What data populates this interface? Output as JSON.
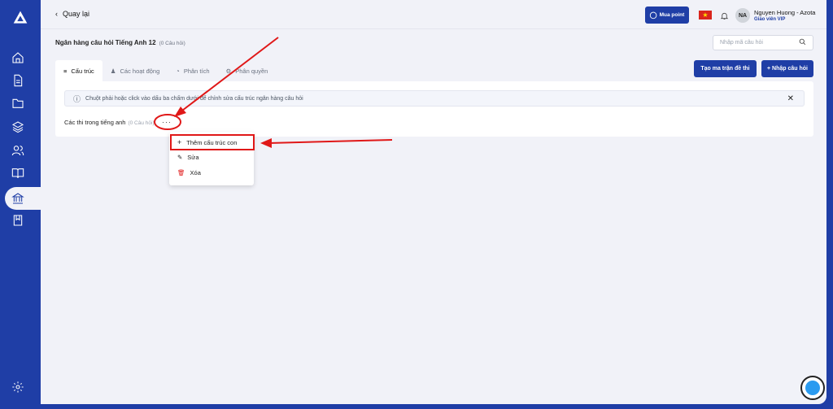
{
  "topbar": {
    "back_label": "Quay lại",
    "buy_point_label": "Mua point",
    "user_initials": "NA",
    "user_name": "Nguyen Huong - Azota",
    "user_role": "Giáo viên VIP"
  },
  "bank": {
    "title": "Ngân hàng câu hỏi Tiếng Anh 12",
    "count": "(0 Câu hỏi)",
    "search_placeholder": "Nhập mã câu hỏi"
  },
  "tabs": [
    {
      "label": "Cấu trúc",
      "icon": "list-icon"
    },
    {
      "label": "Các hoạt động",
      "icon": "users-icon"
    },
    {
      "label": "Phân tích",
      "icon": "chart-pie-icon"
    },
    {
      "label": "Phân quyền",
      "icon": "gear-icon"
    }
  ],
  "actions": {
    "matrix_label": "Tạo ma trận đề thi",
    "import_label": "+ Nhập câu hỏi"
  },
  "notice": {
    "text": "Chuột phải hoặc click vào dấu ba chấm dưới để chỉnh sửa cấu trúc ngân hàng câu hỏi"
  },
  "structure": {
    "node_label": "Các thi trong tiếng anh",
    "node_count": "(0 Câu hỏi)",
    "dots": "···"
  },
  "context_menu": {
    "items": [
      {
        "label": "Thêm cấu trúc con",
        "icon": "plus-icon"
      },
      {
        "label": "Sửa",
        "icon": "pencil-icon"
      },
      {
        "label": "Xóa",
        "icon": "trash-icon"
      }
    ]
  },
  "sidebar": {
    "icons": [
      "logo-icon",
      "home-icon",
      "document-icon",
      "folder-icon",
      "layers-icon",
      "users-icon",
      "book-icon",
      "bank-icon",
      "bookmark-icon",
      "settings-icon"
    ]
  },
  "colors": {
    "brand": "#1f3ea6",
    "annotation": "#e01818"
  }
}
